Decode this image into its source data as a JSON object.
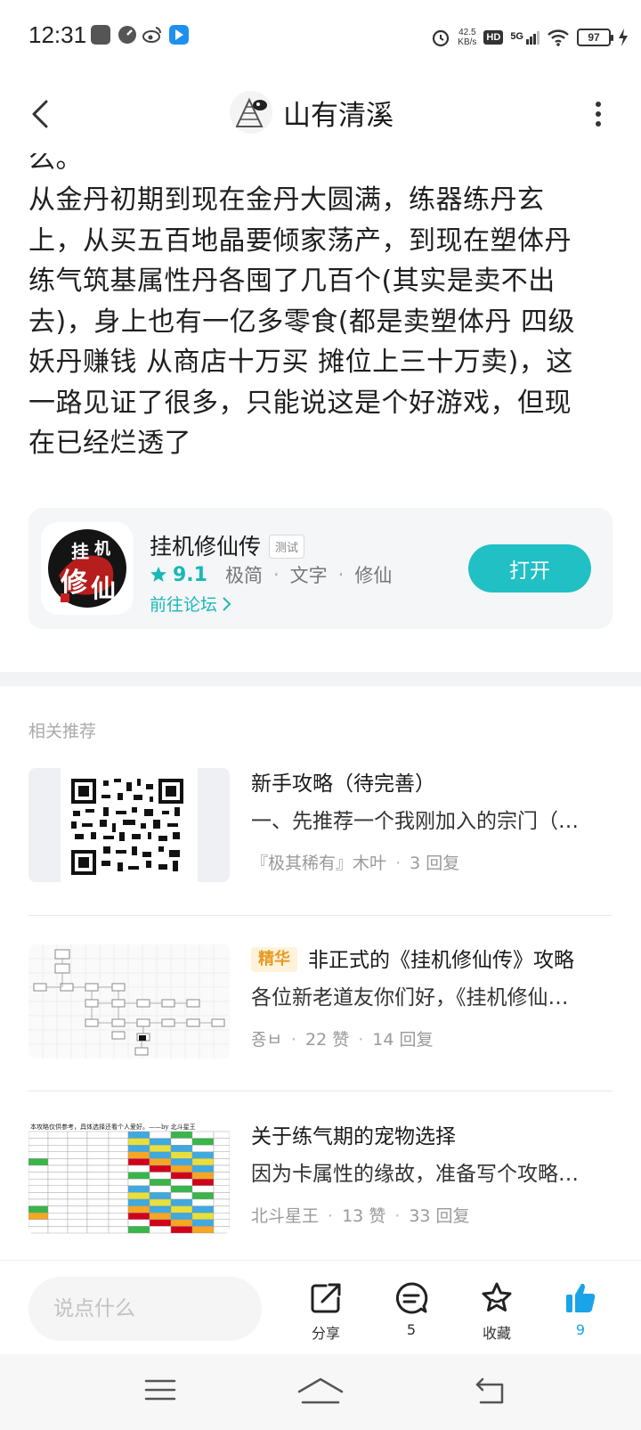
{
  "status_bar": {
    "time": "12:31",
    "net_speed_value": "42.5",
    "net_speed_unit": "KB/s",
    "hd_label": "HD",
    "network": "5G",
    "battery": "97",
    "icons": [
      "youku-icon",
      "gauge-icon",
      "weibo-icon",
      "blue-app-icon",
      "alarm-icon",
      "signal-icon",
      "wifi-icon",
      "battery-icon",
      "charging-icon"
    ]
  },
  "nav": {
    "title": "山有清溪"
  },
  "post": {
    "lines": [
      "么。",
      "从金丹初期到现在金丹大圆满，练器练丹玄",
      "上，从买五百地晶要倾家荡产，到现在塑体丹",
      "练气筑基属性丹各囤了几百个(其实是卖不出",
      "去)，身上也有一亿多零食(都是卖塑体丹  四级",
      "妖丹赚钱  从商店十万买  摊位上三十万卖)，这",
      "一路见证了很多，只能说这是个好游戏，但现",
      "在已经烂透了"
    ]
  },
  "app_card": {
    "icon_text": "挂机修仙",
    "name": "挂机修仙传",
    "badge": "测试",
    "rating": "9.1",
    "tags": [
      "极简",
      "文字",
      "修仙"
    ],
    "forum_link": "前往论坛",
    "open_button": "打开"
  },
  "recommend": {
    "label": "相关推荐",
    "items": [
      {
        "title": "新手攻略（待完善）",
        "summary": "一、先推荐一个我刚加入的宗门（…",
        "author": "『极其稀有』木叶",
        "replies": "3 回复"
      },
      {
        "badge": "精华",
        "title": "非正式的《挂机修仙传》攻略",
        "summary": "各位新老道友你们好，《挂机修仙…",
        "author": "죵ㅂ",
        "likes": "22 赞",
        "replies": "14 回复"
      },
      {
        "title": "关于练气期的宠物选择",
        "summary": "因为卡属性的缘故，准备写个攻略…",
        "author": "北斗星王",
        "likes": "13 赞",
        "replies": "33 回复",
        "thumb_caption": "本攻略仅供参考，具体选择还看个人爱好。——by 北斗星王"
      }
    ]
  },
  "action_bar": {
    "comment_placeholder": "说点什么",
    "share_label": "分享",
    "comment_count": "5",
    "favorite_label": "收藏",
    "like_count": "9",
    "accent_color": "#1aa3e8"
  },
  "colors": {
    "brand_teal": "#20c0c4",
    "badge_orange": "#e79a22"
  }
}
